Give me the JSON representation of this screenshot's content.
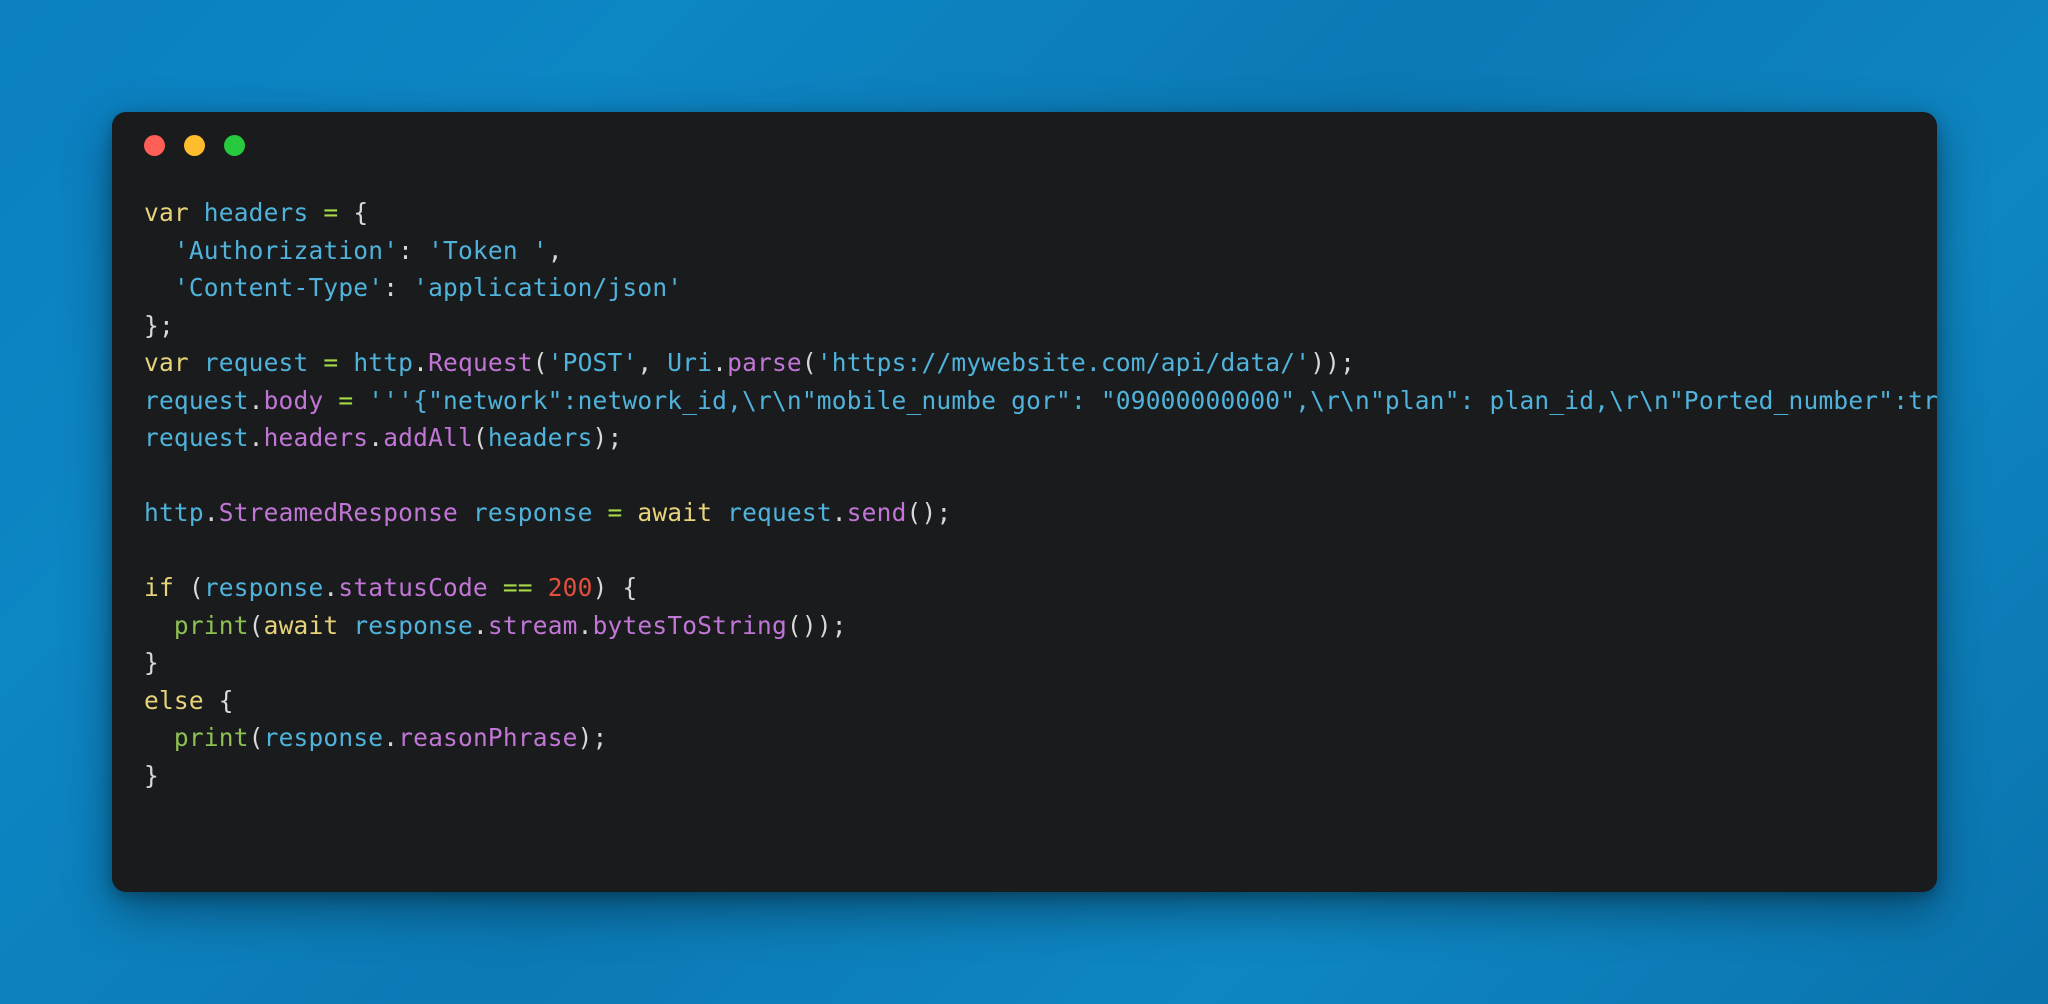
{
  "window": {
    "name": "code-snippet-window",
    "background_gradient_from": "#0b7fc0",
    "background_gradient_to": "#0a73ad",
    "surface_color": "#1a1b1d",
    "traffic_lights": [
      {
        "name": "close-button",
        "label": "Close",
        "color": "#ff5f56"
      },
      {
        "name": "minimize-button",
        "label": "Minimize",
        "color": "#ffbd2e"
      },
      {
        "name": "maximize-button",
        "label": "Maximize",
        "color": "#27c93f"
      }
    ]
  },
  "editor": {
    "language": "dart",
    "theme_colors": {
      "keyword": "#e7d37a",
      "identifier": "#4fb3dc",
      "string": "#4fb3dc",
      "member": "#c176d6",
      "function": "#8cc152",
      "operator": "#a6d847",
      "number": "#e24f3c",
      "punctuation": "#d8d8d8",
      "background": "#1a1b1d"
    },
    "code_plain": "var headers = {\n  'Authorization': 'Token ',\n  'Content-Type': 'application/json'\n};\nvar request = http.Request('POST', Uri.parse('https://mywebsite.com/api/data/'));\nrequest.body = '''{\"network\":network_id,\\r\\n\"mobile_numbe gor\": \"09000000000\",\\r\\n\"plan\": plan_id,\\r\\n\"Ported_number\":true\\r\\n}''';\nrequest.headers.addAll(headers);\n\nhttp.StreamedResponse response = await request.send();\n\nif (response.statusCode == 200) {\n  print(await response.stream.bytesToString());\n}\nelse {\n  print(response.reasonPhrase);\n}",
    "lines": [
      {
        "id": "line-1",
        "tokens": [
          {
            "text": "var",
            "type": "kw"
          },
          {
            "text": " headers ",
            "type": "id"
          },
          {
            "text": "=",
            "type": "op"
          },
          {
            "text": " ",
            "type": "id"
          },
          {
            "text": "{",
            "type": "punct"
          }
        ]
      },
      {
        "id": "line-2",
        "tokens": [
          {
            "text": "  ",
            "type": "id"
          },
          {
            "text": "'Authorization'",
            "type": "str"
          },
          {
            "text": ":",
            "type": "punct"
          },
          {
            "text": " ",
            "type": "id"
          },
          {
            "text": "'Token '",
            "type": "str"
          },
          {
            "text": ",",
            "type": "punct"
          }
        ]
      },
      {
        "id": "line-3",
        "tokens": [
          {
            "text": "  ",
            "type": "id"
          },
          {
            "text": "'Content-Type'",
            "type": "str"
          },
          {
            "text": ":",
            "type": "punct"
          },
          {
            "text": " ",
            "type": "id"
          },
          {
            "text": "'application/json'",
            "type": "str"
          }
        ]
      },
      {
        "id": "line-4",
        "tokens": [
          {
            "text": "};",
            "type": "punct"
          }
        ]
      },
      {
        "id": "line-5",
        "tokens": [
          {
            "text": "var",
            "type": "kw"
          },
          {
            "text": " request ",
            "type": "id"
          },
          {
            "text": "=",
            "type": "op"
          },
          {
            "text": " http",
            "type": "id"
          },
          {
            "text": ".",
            "type": "punct"
          },
          {
            "text": "Request",
            "type": "prop"
          },
          {
            "text": "(",
            "type": "punct"
          },
          {
            "text": "'POST'",
            "type": "str"
          },
          {
            "text": ",",
            "type": "punct"
          },
          {
            "text": " Uri",
            "type": "id"
          },
          {
            "text": ".",
            "type": "punct"
          },
          {
            "text": "parse",
            "type": "prop"
          },
          {
            "text": "(",
            "type": "punct"
          },
          {
            "text": "'https://mywebsite.com/api/data/'",
            "type": "str"
          },
          {
            "text": "));",
            "type": "punct"
          }
        ]
      },
      {
        "id": "line-6",
        "tokens": [
          {
            "text": "request",
            "type": "id"
          },
          {
            "text": ".",
            "type": "punct"
          },
          {
            "text": "body",
            "type": "prop"
          },
          {
            "text": " ",
            "type": "id"
          },
          {
            "text": "=",
            "type": "op"
          },
          {
            "text": " ",
            "type": "id"
          },
          {
            "text": "'''{\"network\":network_id,\\r\\n\"mobile_numbe gor\": \"09000000000\",\\r\\n\"plan\": plan_id,\\r\\n\"Ported_number\":true\\r\\n}'''",
            "type": "str"
          },
          {
            "text": ";",
            "type": "punct"
          }
        ]
      },
      {
        "id": "line-7",
        "tokens": [
          {
            "text": "request",
            "type": "id"
          },
          {
            "text": ".",
            "type": "punct"
          },
          {
            "text": "headers",
            "type": "prop"
          },
          {
            "text": ".",
            "type": "punct"
          },
          {
            "text": "addAll",
            "type": "prop"
          },
          {
            "text": "(",
            "type": "punct"
          },
          {
            "text": "headers",
            "type": "id"
          },
          {
            "text": ");",
            "type": "punct"
          }
        ]
      },
      {
        "id": "line-8",
        "tokens": []
      },
      {
        "id": "line-9",
        "tokens": [
          {
            "text": "http",
            "type": "id"
          },
          {
            "text": ".",
            "type": "punct"
          },
          {
            "text": "StreamedResponse",
            "type": "prop"
          },
          {
            "text": " response ",
            "type": "id"
          },
          {
            "text": "=",
            "type": "op"
          },
          {
            "text": " ",
            "type": "id"
          },
          {
            "text": "await",
            "type": "kw"
          },
          {
            "text": " request",
            "type": "id"
          },
          {
            "text": ".",
            "type": "punct"
          },
          {
            "text": "send",
            "type": "prop"
          },
          {
            "text": "();",
            "type": "punct"
          }
        ]
      },
      {
        "id": "line-10",
        "tokens": []
      },
      {
        "id": "line-11",
        "tokens": [
          {
            "text": "if",
            "type": "kw"
          },
          {
            "text": " ",
            "type": "id"
          },
          {
            "text": "(",
            "type": "punct"
          },
          {
            "text": "response",
            "type": "id"
          },
          {
            "text": ".",
            "type": "punct"
          },
          {
            "text": "statusCode",
            "type": "prop"
          },
          {
            "text": " ",
            "type": "id"
          },
          {
            "text": "==",
            "type": "op"
          },
          {
            "text": " ",
            "type": "id"
          },
          {
            "text": "200",
            "type": "num"
          },
          {
            "text": ") {",
            "type": "punct"
          }
        ]
      },
      {
        "id": "line-12",
        "tokens": [
          {
            "text": "  ",
            "type": "id"
          },
          {
            "text": "print",
            "type": "fn"
          },
          {
            "text": "(",
            "type": "punct"
          },
          {
            "text": "await",
            "type": "kw"
          },
          {
            "text": " response",
            "type": "id"
          },
          {
            "text": ".",
            "type": "punct"
          },
          {
            "text": "stream",
            "type": "prop"
          },
          {
            "text": ".",
            "type": "punct"
          },
          {
            "text": "bytesToString",
            "type": "prop"
          },
          {
            "text": "());",
            "type": "punct"
          }
        ]
      },
      {
        "id": "line-13",
        "tokens": [
          {
            "text": "}",
            "type": "punct"
          }
        ]
      },
      {
        "id": "line-14",
        "tokens": [
          {
            "text": "else",
            "type": "kw"
          },
          {
            "text": " ",
            "type": "id"
          },
          {
            "text": "{",
            "type": "punct"
          }
        ]
      },
      {
        "id": "line-15",
        "tokens": [
          {
            "text": "  ",
            "type": "id"
          },
          {
            "text": "print",
            "type": "fn"
          },
          {
            "text": "(",
            "type": "punct"
          },
          {
            "text": "response",
            "type": "id"
          },
          {
            "text": ".",
            "type": "punct"
          },
          {
            "text": "reasonPhrase",
            "type": "prop"
          },
          {
            "text": ");",
            "type": "punct"
          }
        ]
      },
      {
        "id": "line-16",
        "tokens": [
          {
            "text": "}",
            "type": "punct"
          }
        ]
      }
    ]
  }
}
